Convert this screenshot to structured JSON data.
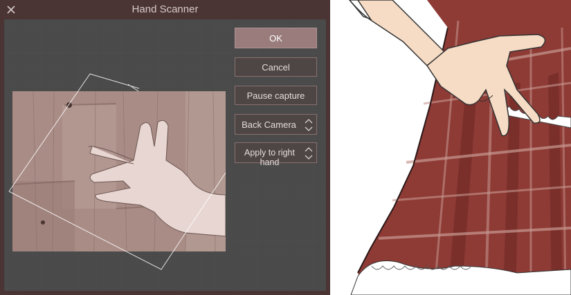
{
  "dialog": {
    "title": "Hand Scanner",
    "buttons": {
      "ok_label": "OK",
      "cancel_label": "Cancel",
      "pause_label": "Pause capture"
    },
    "camera_select": {
      "selected": "Back Camera"
    },
    "hand_select": {
      "selected": "Apply to right hand"
    }
  },
  "icons": {
    "close": "close-icon",
    "select_arrows": "chevron-up-down-icon"
  },
  "colors": {
    "titlebar": "#4b3434",
    "dialog_bg": "#4a4a4a",
    "ok_button": "#9a7c7c",
    "button_border": "#8a7070"
  }
}
